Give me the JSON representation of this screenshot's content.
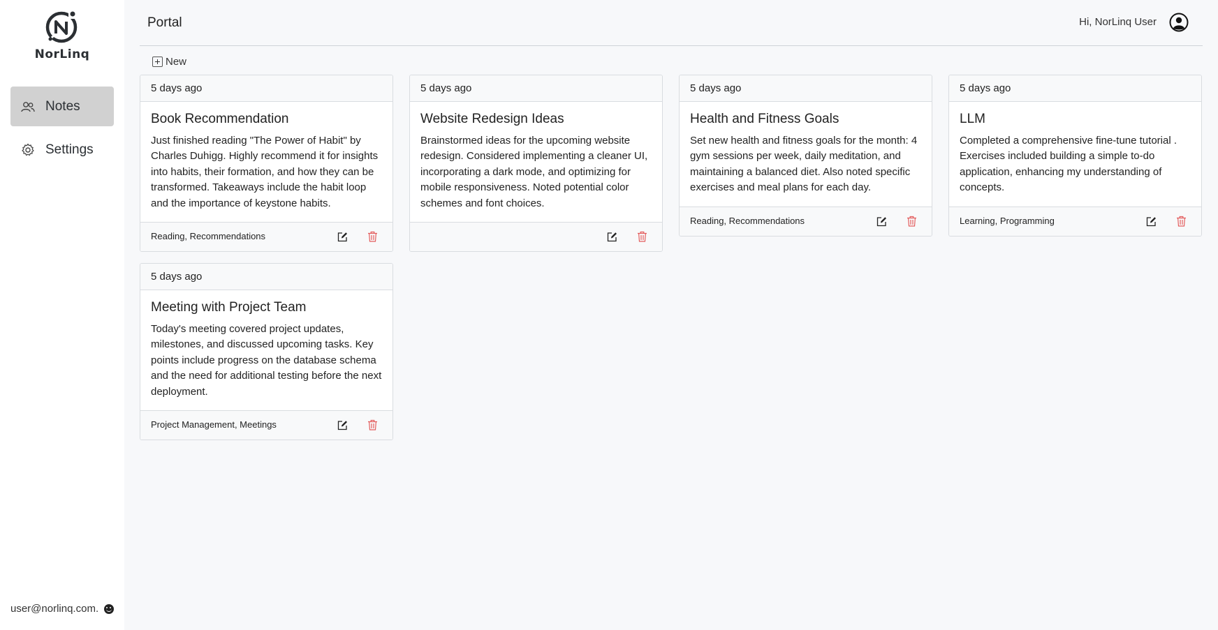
{
  "app": {
    "name": "NorLinq"
  },
  "sidebar": {
    "items": [
      {
        "label": "Notes",
        "icon": "people-icon",
        "active": true
      },
      {
        "label": "Settings",
        "icon": "gear-icon",
        "active": false
      }
    ],
    "footer_email": "user@norlinq.com."
  },
  "header": {
    "title": "Portal",
    "greeting": "Hi, NorLinq User",
    "user_icon": "user-circle-icon"
  },
  "toolbar": {
    "new_label": "New"
  },
  "notes": [
    {
      "timestamp": "5 days ago",
      "title": "Book Recommendation",
      "body": "Just finished reading \"The Power of Habit\" by Charles Duhigg. Highly recommend it for insights into habits, their formation, and how they can be transformed. Takeaways include the habit loop and the importance of keystone habits.",
      "tags": "Reading, Recommendations"
    },
    {
      "timestamp": "5 days ago",
      "title": "Website Redesign Ideas",
      "body": "Brainstormed ideas for the upcoming website redesign. Considered implementing a cleaner UI, incorporating a dark mode, and optimizing for mobile responsiveness. Noted potential color schemes and font choices.",
      "tags": ""
    },
    {
      "timestamp": "5 days ago",
      "title": "Health and Fitness Goals",
      "body": "Set new health and fitness goals for the month: 4 gym sessions per week, daily meditation, and maintaining a balanced diet. Also noted specific exercises and meal plans for each day.",
      "tags": "Reading, Recommendations"
    },
    {
      "timestamp": "5 days ago",
      "title": "LLM",
      "body": "Completed a comprehensive fine-tune tutorial . Exercises included building a simple to-do application, enhancing my understanding of concepts.",
      "tags": "Learning, Programming"
    },
    {
      "timestamp": "5 days ago",
      "title": "Meeting with Project Team",
      "body": "Today's meeting covered project updates, milestones, and discussed upcoming tasks. Key points include progress on the database schema and the need for additional testing before the next deployment.",
      "tags": "Project Management, Meetings"
    }
  ],
  "colors": {
    "active_nav": "#d1d1d1",
    "delete": "#e35d5d",
    "border": "#d9dce0"
  }
}
